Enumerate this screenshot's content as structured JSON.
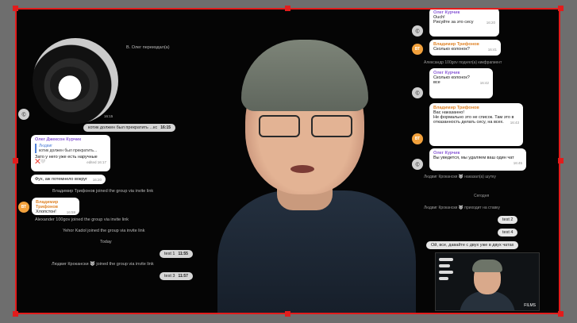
{
  "left_chat": {
    "top_system": "В. Олег переиздал(а)",
    "video_time": "16:15",
    "msg1": {
      "text": "котик должен был прекратить ...кс",
      "time": "16:15"
    },
    "reply_block": {
      "sender": "Олег Джексон Курчик",
      "quote_author": "Людвиг",
      "quote_text": "котик должен был прекратить...",
      "text": "Зато у него уже есть наручные",
      "emoji": "❌🤍",
      "time": "edited 16:17"
    },
    "msg2": {
      "text": "Фух, аж потемнело вокруг",
      "time": "16:20"
    },
    "join1": "Владимир Трифонов joined the group via invite link",
    "vlad_msg": {
      "sender": "Владимир Трифонов",
      "text": "Хлопстон!",
      "time": "16:59"
    },
    "join2": "Alexander 100gov joined the group via invite link",
    "join3": "Yehor Kadol joined the group via invite link",
    "day": "Today",
    "test1": {
      "text": "test 1",
      "time": "11:55"
    },
    "join4": "Людвиг Крокански 🐺 joined the group via invite link",
    "test3": {
      "text": "test 3",
      "time": "11:57"
    }
  },
  "right_chat": {
    "b1": {
      "sender": "Олег Курчик",
      "text": "Ouch!",
      "text2": "Рисуйте за это сесу",
      "time": "16:20"
    },
    "b2": {
      "sender": "Владимир Трифонов",
      "text": "Сколько колонок?",
      "time": "16:41"
    },
    "sys1": "Александр 100gov поднял(а) кикфрагмент",
    "b3": {
      "sender": "Олег Курчик",
      "text": "Сколько колонок?",
      "text2": "все",
      "time": "16:42"
    },
    "b4": {
      "sender": "Владимир Трифонов",
      "text": "Вас наказанно!",
      "text2": "Не формально это не список. Там это в отказанность делать сесу, на всех.",
      "time": "16:43"
    },
    "b5": {
      "sender": "Олег Курчик",
      "text": "Вы уведется, мы удаляем ваш один чат",
      "time": "16:45"
    },
    "sys2": "Людвиг Крокански 🐺 наказал(а) шутку",
    "sys3": "Сегодня",
    "sys4": "Людвиг Крокански 🐺 приходит на ставку",
    "test2": "test 2",
    "test4": "test 4",
    "long": "Ой, все, давайте с двух уже в двух чатах"
  },
  "avatars": {
    "grey": "Ⓒ",
    "orange": "ВТ"
  },
  "pip": {
    "badge": "FILMS"
  },
  "colors": {
    "frame": "#e21c1c",
    "orange": "#e0852b",
    "purple": "#8b5bd6"
  }
}
